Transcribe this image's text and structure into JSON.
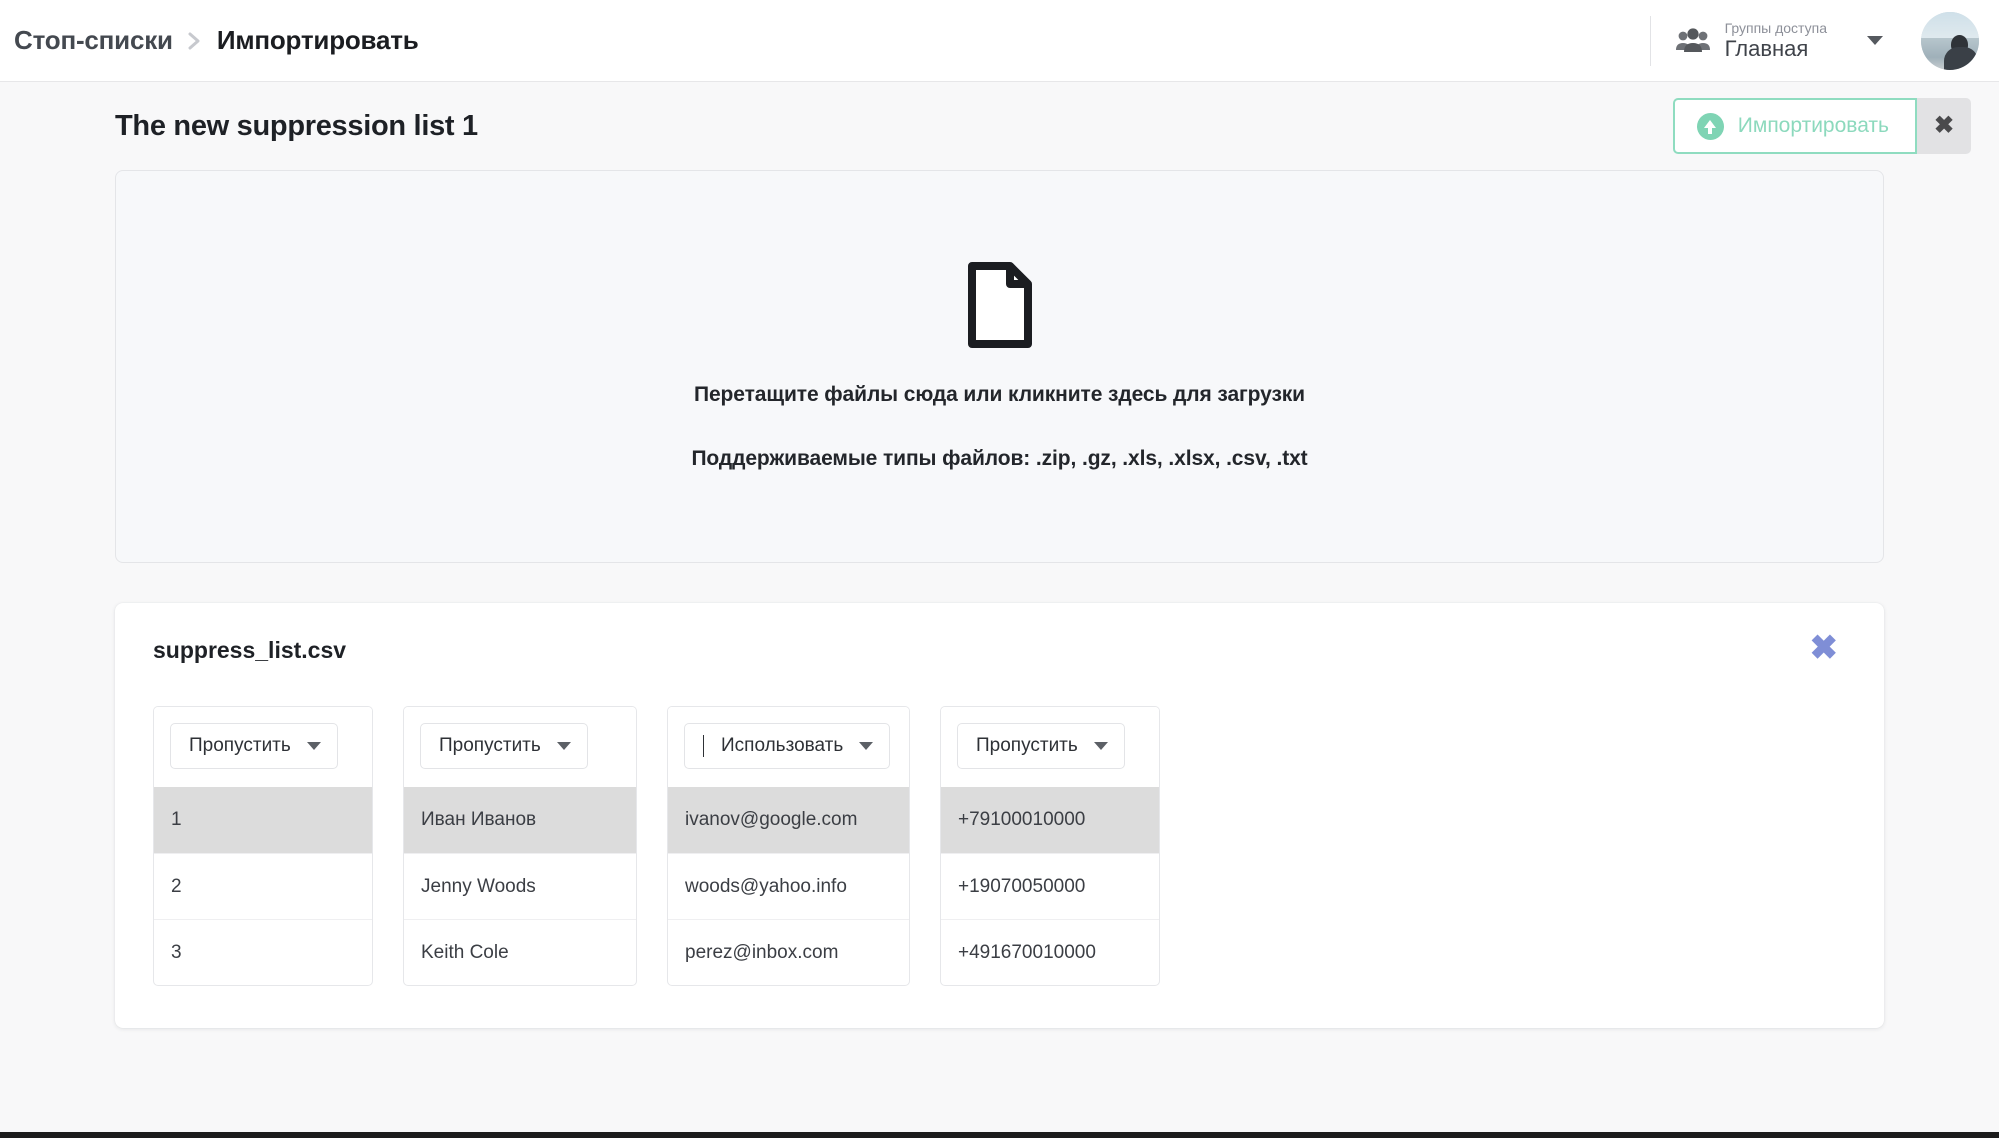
{
  "topbar": {
    "breadcrumb_root": "Стоп-списки",
    "breadcrumb_separator": "❯",
    "breadcrumb_current": "Импортировать",
    "group_selector": {
      "label": "Группы доступа",
      "value": "Главная",
      "icon": "group-people-icon",
      "caret": "chevron-down-icon"
    },
    "avatar_alt": "avatar"
  },
  "page": {
    "title": "The new suppression list 1",
    "import_button_label": "Импортировать",
    "import_button_icon": "upload-circle-icon",
    "import_button_border_color": "#8fdcc0",
    "import_button_text_color": "#8cd9bd",
    "close_button_icon": "close-icon",
    "close_button_glyph": "✖"
  },
  "dropzone": {
    "icon": "file-document-icon",
    "primary_text": "Перетащите файлы сюда или кликните здесь для загрузки",
    "secondary_text": "Поддерживаемые типы файлов: .zip, .gz, .xls, .xlsx, .csv, .txt"
  },
  "file_card": {
    "file_name": "suppress_list.csv",
    "remove_icon": "close-icon",
    "remove_glyph": "✖",
    "remove_color": "#7f8ed6",
    "highlight_row_color": "#dcdcdc",
    "columns": [
      {
        "action": "Пропустить",
        "has_text_cursor": false,
        "rows": [
          "1",
          "2",
          "3"
        ]
      },
      {
        "action": "Пропустить",
        "has_text_cursor": false,
        "rows": [
          "Иван Иванов",
          "Jenny Woods",
          "Keith Cole"
        ]
      },
      {
        "action": "Использовать",
        "has_text_cursor": true,
        "rows": [
          "ivanov@google.com",
          "woods@yahoo.info",
          "perez@inbox.com"
        ]
      },
      {
        "action": "Пропустить",
        "has_text_cursor": false,
        "rows": [
          "+79100010000",
          "+19070050000",
          "+491670010000"
        ]
      }
    ]
  }
}
